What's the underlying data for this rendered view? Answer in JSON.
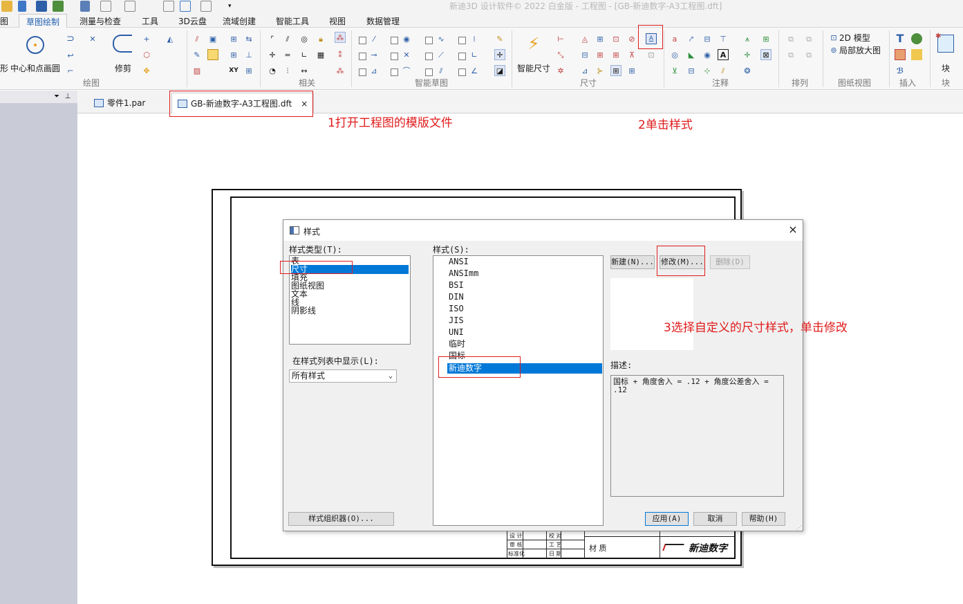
{
  "window": {
    "title": "新迪3D 设计软件© 2022 白金版 - 工程图 - [GB-新迪数字-A3工程图.dft]"
  },
  "ribbon": {
    "file_tab_fragment": "图",
    "tabs": [
      "草图绘制",
      "测量与检查",
      "工具",
      "3D云盘",
      "流域创建",
      "智能工具",
      "视图",
      "数据管理"
    ],
    "active_tab": "草图绘制",
    "big_buttons": {
      "shape_fragment": "形",
      "circle_center": "中心和点画圆",
      "trim": "修剪",
      "smart_dimension": "智能尺寸",
      "model_2d": "2D 模型",
      "detail_view": "局部放大图",
      "block": "块"
    },
    "groups": [
      "绘图",
      "相关",
      "智能草图",
      "尺寸",
      "注释",
      "排列",
      "图纸视图",
      "插入",
      "块"
    ],
    "xy_label": "XY"
  },
  "doc_tabs": [
    {
      "label": "零件1.par",
      "active": false
    },
    {
      "label": "GB-新迪数字-A3工程图.dft",
      "active": true,
      "close": "×"
    }
  ],
  "dialog": {
    "title": "样式",
    "close": "×",
    "style_type_label": "样式类型(T):",
    "style_types": [
      "表",
      "尺寸",
      "填充",
      "图纸视图",
      "文本",
      "线",
      "阴影线"
    ],
    "selected_style_type": "尺寸",
    "styles_label": "样式(S):",
    "styles": [
      "ANSI",
      "ANSImm",
      "BSI",
      "DIN",
      "ISO",
      "JIS",
      "UNI",
      "临时",
      "国标",
      "新迪数字"
    ],
    "selected_style": "新迪数字",
    "show_label": "在样式列表中显示(L):",
    "show_value": "所有样式",
    "buttons": {
      "new": "新建(N)...",
      "modify": "修改(M)...",
      "delete": "删除(D)",
      "organizer": "样式组织器(O)...",
      "apply": "应用(A)",
      "cancel": "取消",
      "help": "帮助(H)"
    },
    "description_label": "描述:",
    "description": "国标 + 角度舍入 = .12 + 角度公差舍入 = .12"
  },
  "title_block": {
    "cells": [
      "设 计",
      "校 对",
      "审 核",
      "工 艺",
      "标准化",
      "日 期",
      "材 质"
    ],
    "logo_text": "新迪数字"
  },
  "annotations": {
    "step1": "1打开工程图的模版文件",
    "step2": "2单击样式",
    "step3": "3选择自定义的尺寸样式，单击修改"
  },
  "colors": {
    "annotation_red": "#e01b1b",
    "selection_blue": "#0078d7",
    "ribbon_bg": "#f7f7f7",
    "left_panel": "#c9cbd7"
  }
}
